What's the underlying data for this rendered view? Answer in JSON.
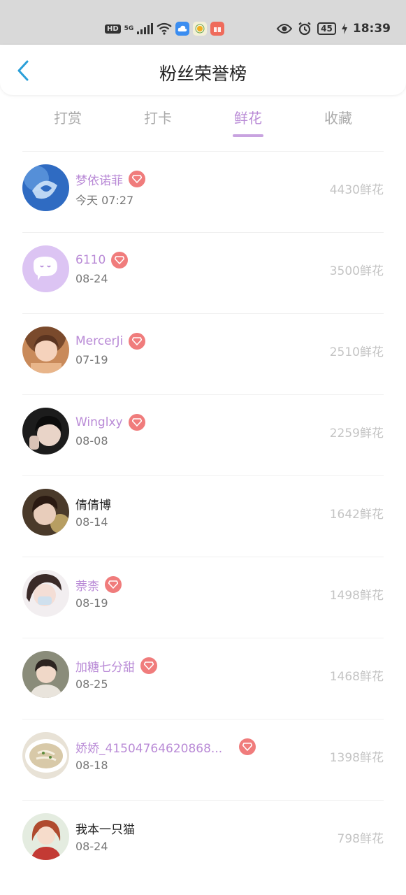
{
  "status_bar": {
    "network_hd": "HD",
    "network_5g": "5G",
    "battery": "45",
    "time": "18:39"
  },
  "header": {
    "title": "粉丝荣誉榜"
  },
  "tabs": [
    {
      "label": "打赏",
      "active": false
    },
    {
      "label": "打卡",
      "active": false
    },
    {
      "label": "鲜花",
      "active": true
    },
    {
      "label": "收藏",
      "active": false
    }
  ],
  "fans": [
    {
      "name": "梦依诺菲",
      "date": "今天 07:27",
      "amount": "4430鲜花",
      "vip": true
    },
    {
      "name": "6110",
      "date": "08-24",
      "amount": "3500鲜花",
      "vip": true
    },
    {
      "name": "MercerJi",
      "date": "07-19",
      "amount": "2510鲜花",
      "vip": true
    },
    {
      "name": "Winglxy",
      "date": "08-08",
      "amount": "2259鲜花",
      "vip": true
    },
    {
      "name": "倩倩博",
      "date": "08-14",
      "amount": "1642鲜花",
      "vip": false
    },
    {
      "name": "萘柰",
      "date": "08-19",
      "amount": "1498鲜花",
      "vip": true
    },
    {
      "name": "加糖七分甜",
      "date": "08-25",
      "amount": "1468鲜花",
      "vip": true
    },
    {
      "name": "娇娇_41504764620868...",
      "date": "08-18",
      "amount": "1398鲜花",
      "vip": true
    },
    {
      "name": "我本一只猫",
      "date": "08-24",
      "amount": "798鲜花",
      "vip": false
    }
  ],
  "colors": {
    "accent": "#b98ad6",
    "badge": "#f07c7c",
    "back_arrow": "#2a9fd8"
  }
}
